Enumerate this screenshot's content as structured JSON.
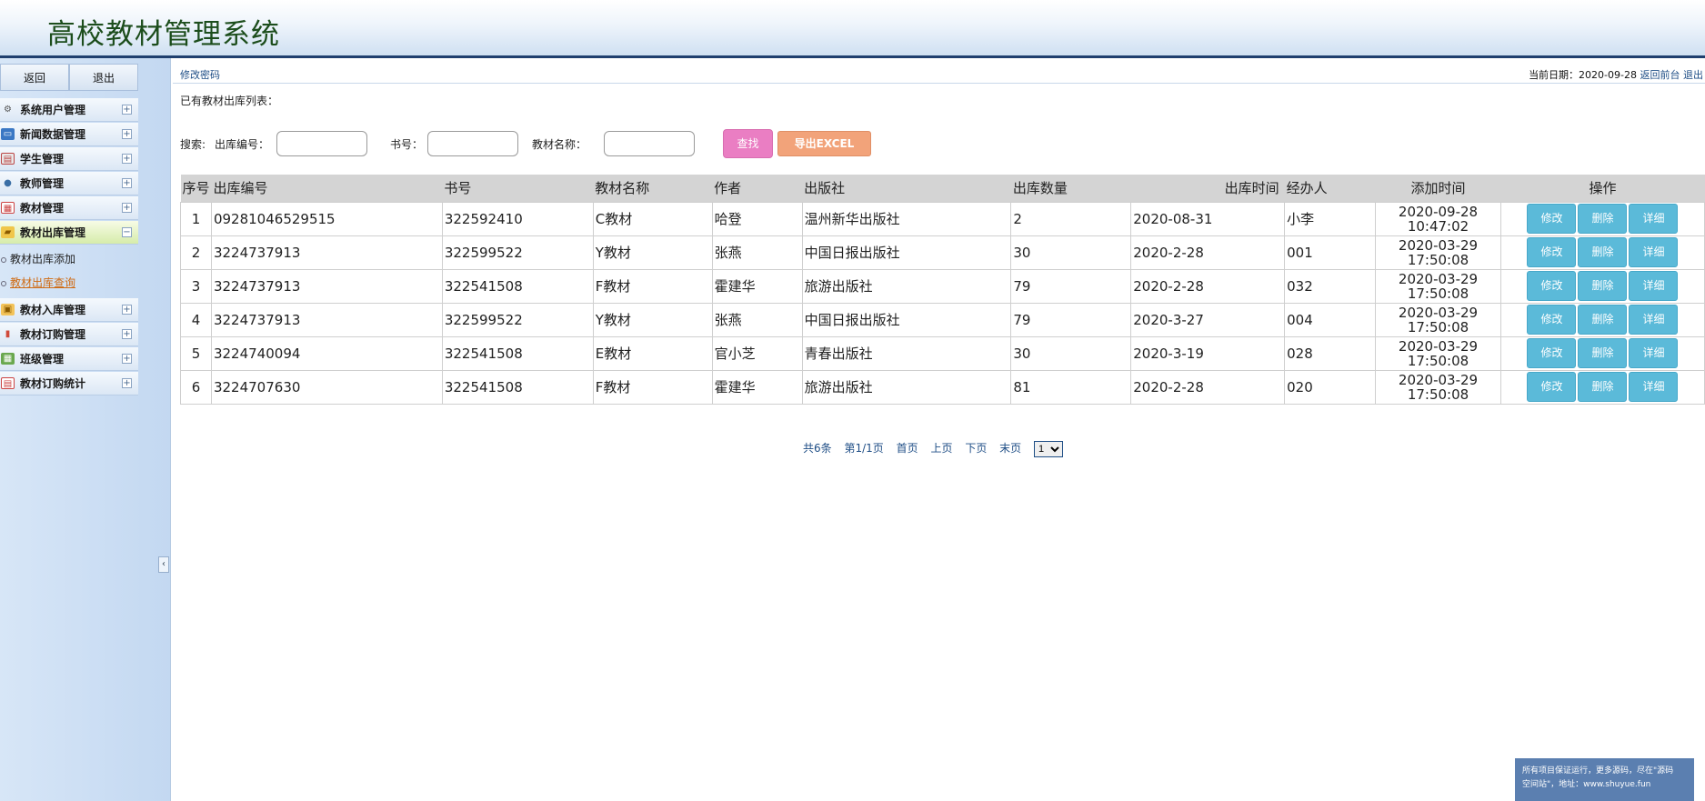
{
  "app": {
    "title": "高校教材管理系统"
  },
  "sidebar": {
    "back_label": "返回",
    "logout_label": "退出",
    "menu": [
      {
        "label": "系统用户管理",
        "icon": "gear-icon",
        "expand": "+"
      },
      {
        "label": "新闻数据管理",
        "icon": "monitor-icon",
        "expand": "+"
      },
      {
        "label": "学生管理",
        "icon": "table-icon",
        "expand": "+"
      },
      {
        "label": "教师管理",
        "icon": "user-icon",
        "expand": "+"
      },
      {
        "label": "教材管理",
        "icon": "calendar-icon",
        "expand": "+"
      },
      {
        "label": "教材出库管理",
        "icon": "folder-icon",
        "expand": "−"
      },
      {
        "label": "教材入库管理",
        "icon": "box-icon",
        "expand": "+"
      },
      {
        "label": "教材订购管理",
        "icon": "chart-icon",
        "expand": "+"
      },
      {
        "label": "班级管理",
        "icon": "grid-icon",
        "expand": "+"
      },
      {
        "label": "教材订购统计",
        "icon": "stats-icon",
        "expand": "+"
      }
    ],
    "submenu": [
      {
        "label": "教材出库添加"
      },
      {
        "label": "教材出库查询"
      }
    ],
    "collapse_glyph": "‹"
  },
  "topbar": {
    "change_password": "修改密码",
    "date_label": "当前日期：2020-09-28",
    "front_link": "返回前台",
    "logout_link": "退出"
  },
  "list_title": "已有教材出库列表：",
  "search": {
    "prefix": "搜索:",
    "outbound_no_label": "出库编号：",
    "book_no_label": "书号：",
    "name_label": "教材名称：",
    "find_label": "查找",
    "export_label": "导出EXCEL"
  },
  "table": {
    "headers": [
      "序号",
      "出库编号",
      "书号",
      "教材名称",
      "作者",
      "出版社",
      "出库数量",
      "出库时间",
      "经办人",
      "添加时间",
      "操作"
    ],
    "rows": [
      {
        "idx": "1",
        "out_no": "09281046529515",
        "book_no": "322592410",
        "name": "C教材",
        "author": "哈登",
        "publisher": "温州新华出版社",
        "qty": "2",
        "out_time": "2020-08-31",
        "handler": "小李",
        "add_date": "2020-09-28",
        "add_time": "10:47:02"
      },
      {
        "idx": "2",
        "out_no": "3224737913",
        "book_no": "322599522",
        "name": "Y教材",
        "author": "张燕",
        "publisher": "中国日报出版社",
        "qty": "30",
        "out_time": "2020-2-28",
        "handler": "001",
        "add_date": "2020-03-29",
        "add_time": "17:50:08"
      },
      {
        "idx": "3",
        "out_no": "3224737913",
        "book_no": "322541508",
        "name": "F教材",
        "author": "霍建华",
        "publisher": "旅游出版社",
        "qty": "79",
        "out_time": "2020-2-28",
        "handler": "032",
        "add_date": "2020-03-29",
        "add_time": "17:50:08"
      },
      {
        "idx": "4",
        "out_no": "3224737913",
        "book_no": "322599522",
        "name": "Y教材",
        "author": "张燕",
        "publisher": "中国日报出版社",
        "qty": "79",
        "out_time": "2020-3-27",
        "handler": "004",
        "add_date": "2020-03-29",
        "add_time": "17:50:08"
      },
      {
        "idx": "5",
        "out_no": "3224740094",
        "book_no": "322541508",
        "name": "E教材",
        "author": "官小芝",
        "publisher": "青春出版社",
        "qty": "30",
        "out_time": "2020-3-19",
        "handler": "028",
        "add_date": "2020-03-29",
        "add_time": "17:50:08"
      },
      {
        "idx": "6",
        "out_no": "3224707630",
        "book_no": "322541508",
        "name": "F教材",
        "author": "霍建华",
        "publisher": "旅游出版社",
        "qty": "81",
        "out_time": "2020-2-28",
        "handler": "020",
        "add_date": "2020-03-29",
        "add_time": "17:50:08"
      }
    ],
    "actions": {
      "edit": "修改",
      "delete": "删除",
      "detail": "详细"
    }
  },
  "pager": {
    "total": "共6条",
    "page_info": "第1/1页",
    "first": "首页",
    "prev": "上页",
    "next": "下页",
    "last": "末页",
    "current_page": "1"
  },
  "watermark": {
    "line1": "所有项目保证运行，更多源码，尽在\"源码",
    "line2": "空间站\"，地址：www.shuyue.fun"
  }
}
